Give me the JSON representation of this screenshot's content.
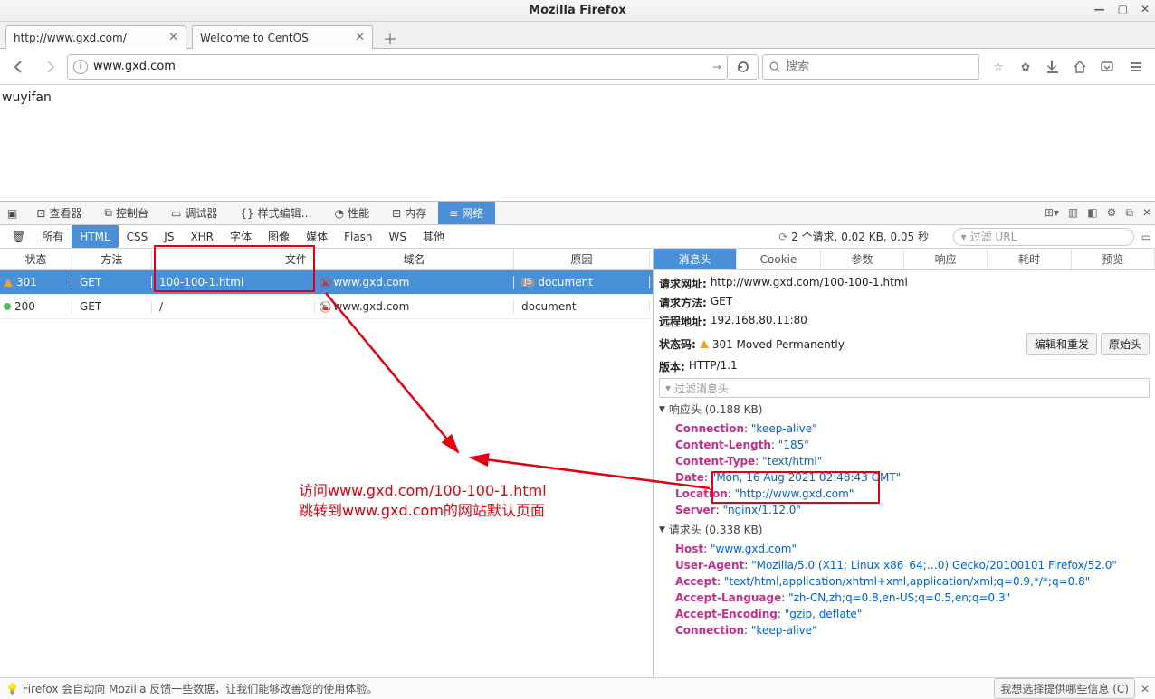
{
  "window": {
    "title": "Mozilla Firefox"
  },
  "tabs": [
    {
      "label": "http://www.gxd.com/"
    },
    {
      "label": "Welcome to CentOS"
    }
  ],
  "urlbar": {
    "value": "www.gxd.com"
  },
  "searchbar": {
    "placeholder": "搜索"
  },
  "page_text": "wuyifan",
  "devtools": {
    "tabs": {
      "inspector": "查看器",
      "console": "控制台",
      "debugger": "调试器",
      "style": "样式编辑…",
      "perf": "性能",
      "memory": "内存",
      "network": "网络"
    },
    "filters": {
      "trash": "",
      "all": "所有",
      "html": "HTML",
      "css": "CSS",
      "js": "JS",
      "xhr": "XHR",
      "font": "字体",
      "image": "图像",
      "media": "媒体",
      "flash": "Flash",
      "ws": "WS",
      "other": "其他"
    },
    "summary": "2 个请求, 0.02 KB, 0.05 秒",
    "filter_url_placeholder": "过滤 URL",
    "columns": {
      "status": "状态",
      "method": "方法",
      "file": "文件",
      "domain": "域名",
      "cause": "原因"
    },
    "rows": [
      {
        "status": "301",
        "method": "GET",
        "file": "100-100-1.html",
        "domain": "www.gxd.com",
        "cause": "document",
        "selected": true,
        "warn": true
      },
      {
        "status": "200",
        "method": "GET",
        "file": "/",
        "domain": "www.gxd.com",
        "cause": "document",
        "selected": false,
        "ok": true
      }
    ],
    "detail_tabs": {
      "headers": "消息头",
      "cookies": "Cookie",
      "params": "参数",
      "response": "响应",
      "timings": "耗时",
      "preview": "预览"
    },
    "detail": {
      "url_label": "请求网址:",
      "url": "http://www.gxd.com/100-100-1.html",
      "method_label": "请求方法:",
      "method": "GET",
      "remote_label": "远程地址:",
      "remote": "192.168.80.11:80",
      "status_label": "状态码:",
      "status": "301 Moved Permanently",
      "version_label": "版本:",
      "version": "HTTP/1.1",
      "edit_resend": "编辑和重发",
      "raw": "原始头",
      "filter_msg_placeholder": "过滤消息头",
      "resp_head_label": "响应头 (0.188 KB)",
      "resp_headers": [
        {
          "n": "Connection",
          "v": "\"keep-alive\""
        },
        {
          "n": "Content-Length",
          "v": "\"185\""
        },
        {
          "n": "Content-Type",
          "v": "\"text/html\""
        },
        {
          "n": "Date",
          "v": "\"Mon, 16 Aug 2021 02:48:43 GMT\""
        },
        {
          "n": "Location",
          "v": "\"http://www.gxd.com\""
        },
        {
          "n": "Server",
          "v": "\"nginx/1.12.0\""
        }
      ],
      "req_head_label": "请求头 (0.338 KB)",
      "req_headers": [
        {
          "n": "Host",
          "v": "\"www.gxd.com\""
        },
        {
          "n": "User-Agent",
          "v": "\"Mozilla/5.0 (X11; Linux x86_64;…0) Gecko/20100101 Firefox/52.0\""
        },
        {
          "n": "Accept",
          "v": "\"text/html,application/xhtml+xml,application/xml;q=0.9,*/*;q=0.8\""
        },
        {
          "n": "Accept-Language",
          "v": "\"zh-CN,zh;q=0.8,en-US;q=0.5,en;q=0.3\""
        },
        {
          "n": "Accept-Encoding",
          "v": "\"gzip, deflate\""
        },
        {
          "n": "Connection",
          "v": "\"keep-alive\""
        }
      ]
    }
  },
  "footer": {
    "text": "Firefox 会自动向 Mozilla 反馈一些数据，让我们能够改善您的使用体验。",
    "button": "我想选择提供哪些信息 (C)"
  },
  "annotations": {
    "line1": "访问www.gxd.com/100-100-1.html",
    "line2": "跳转到www.gxd.com的网站默认页面"
  }
}
